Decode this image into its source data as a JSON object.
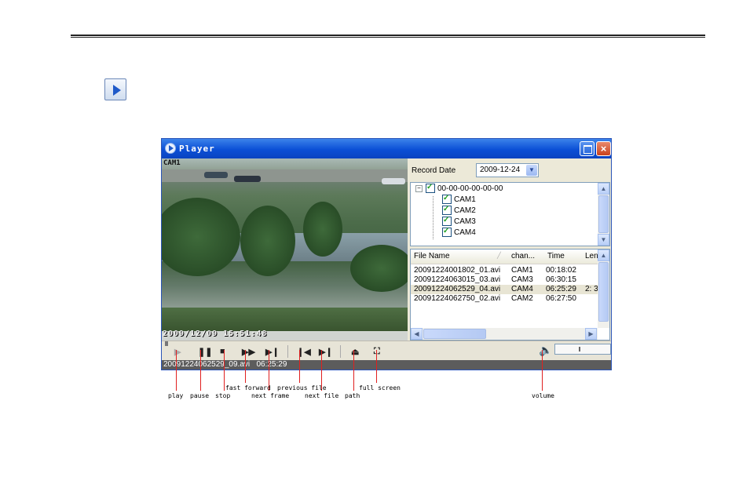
{
  "player": {
    "title": "Player",
    "video": {
      "camera_label": "CAM1",
      "osd_timestamp": "2009/12/09 15:51:48"
    },
    "record_date": {
      "label": "Record Date",
      "value": "2009-12-24"
    },
    "tree": {
      "root": "00-00-00-00-00-00",
      "channels": [
        "CAM1",
        "CAM2",
        "CAM3",
        "CAM4"
      ]
    },
    "files": {
      "columns": [
        "File Name",
        "chan...",
        "Time",
        "Leng"
      ],
      "rows": [
        {
          "name": "20091224001802_01.avi",
          "channel": "CAM1",
          "time": "00:18:02",
          "length": ""
        },
        {
          "name": "20091224063015_03.avi",
          "channel": "CAM3",
          "time": "06:30:15",
          "length": ""
        },
        {
          "name": "20091224062529_04.avi",
          "channel": "CAM4",
          "time": "06:25:29",
          "length": "2: 3"
        },
        {
          "name": "20091224062750_02.avi",
          "channel": "CAM2",
          "time": "06:27:50",
          "length": ""
        }
      ],
      "selected_index": 2
    },
    "status": {
      "filename": "20091224062529_09.avi",
      "time": "06:25:29"
    }
  },
  "annotations": {
    "play": "play",
    "pause": "pause",
    "stop": "stop",
    "fast_forward": "fast forward",
    "next_frame": "next frame",
    "previous_file": "previous file",
    "next_file": "next file",
    "path": "path",
    "full_screen": "full screen",
    "volume": "volume"
  },
  "colors": {
    "titlebar": "#0b4fd6",
    "annotation_line": "#e02020"
  }
}
